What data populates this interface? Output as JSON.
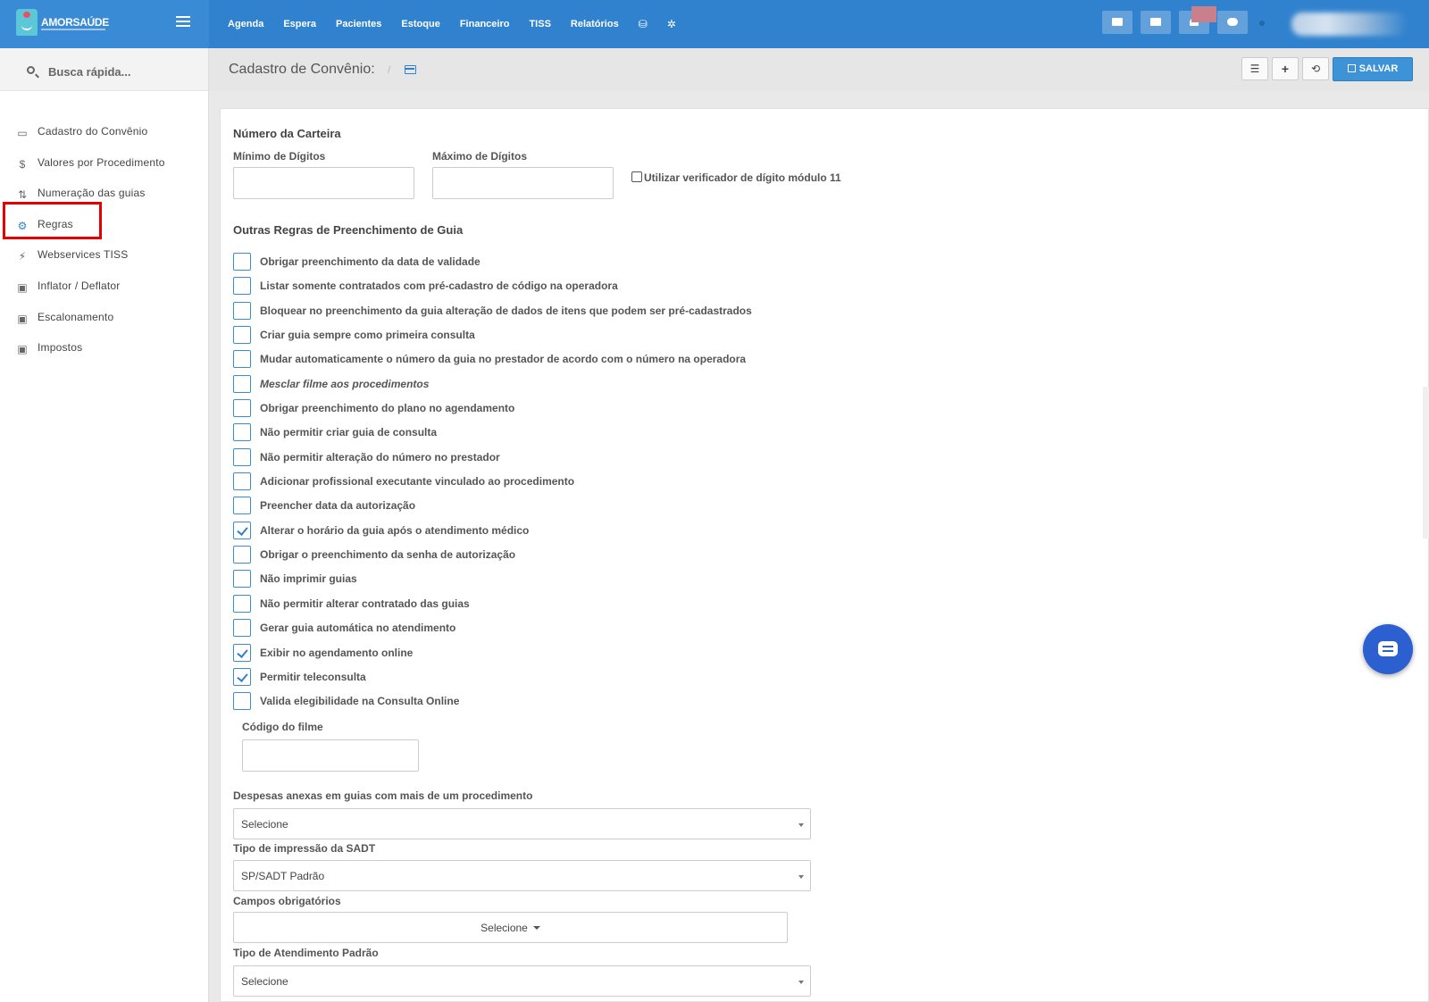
{
  "app": {
    "logo_text": "AMORSAÚDE"
  },
  "topnav": {
    "items": [
      "Agenda",
      "Espera",
      "Pacientes",
      "Estoque",
      "Financeiro",
      "TISS",
      "Relatórios"
    ]
  },
  "sidebar": {
    "search_label": "Busca rápida...",
    "items": [
      {
        "label": "Cadastro do Convênio",
        "icon": "credit-card-icon"
      },
      {
        "label": "Valores por Procedimento",
        "icon": "dollar-icon"
      },
      {
        "label": "Numeração das guias",
        "icon": "sort-numeric-icon"
      },
      {
        "label": "Regras",
        "icon": "cogs-icon"
      },
      {
        "label": "Webservices TISS",
        "icon": "plug-icon"
      },
      {
        "label": "Inflator / Deflator",
        "icon": "money-icon"
      },
      {
        "label": "Escalonamento",
        "icon": "money-icon"
      },
      {
        "label": "Impostos",
        "icon": "money-icon"
      }
    ]
  },
  "header": {
    "title": "Cadastro de Convênio:",
    "separator": "/",
    "save_label": "SALVAR",
    "add_symbol": "+",
    "list_symbol": "☰",
    "history_symbol": "⟲"
  },
  "carteira": {
    "section_title": "Número da Carteira",
    "min_label": "Mínimo de Dígitos",
    "max_label": "Máximo de Dígitos",
    "min_value": "",
    "max_value": "",
    "mod11_label": "Utilizar verificador de dígito módulo 11",
    "mod11_checked": false
  },
  "rules": {
    "section_title": "Outras Regras de Preenchimento de Guia",
    "items": [
      {
        "label": "Obrigar preenchimento da data de validade",
        "checked": false
      },
      {
        "label": "Listar somente contratados com pré-cadastro de código na operadora",
        "checked": false
      },
      {
        "label": "Bloquear no preenchimento da guia alteração de dados de itens que podem ser pré-cadastrados",
        "checked": false
      },
      {
        "label": "Criar guia sempre como primeira consulta",
        "checked": false
      },
      {
        "label": "Mudar automaticamente o número da guia no prestador de acordo com o número na operadora",
        "checked": false
      },
      {
        "label": "Mesclar filme aos procedimentos",
        "checked": false,
        "italic": true
      },
      {
        "label": "Obrigar preenchimento do plano no agendamento",
        "checked": false
      },
      {
        "label": "Não permitir criar guia de consulta",
        "checked": false
      },
      {
        "label": "Não permitir alteração do número no prestador",
        "checked": false
      },
      {
        "label": "Adicionar profissional executante vinculado ao procedimento",
        "checked": false
      },
      {
        "label": "Preencher data da autorização",
        "checked": false
      },
      {
        "label": "Alterar o horário da guia após o atendimento médico",
        "checked": true
      },
      {
        "label": "Obrigar o preenchimento da senha de autorização",
        "checked": false
      },
      {
        "label": "Não imprimir guias",
        "checked": false
      },
      {
        "label": "Não permitir alterar contratado das guias",
        "checked": false
      },
      {
        "label": "Gerar guia automática no atendimento",
        "checked": false
      },
      {
        "label": "Exibir no agendamento online",
        "checked": true
      },
      {
        "label": "Permitir teleconsulta",
        "checked": true
      },
      {
        "label": "Valida elegibilidade na Consulta Online",
        "checked": false
      }
    ]
  },
  "filme": {
    "label": "Código do filme",
    "value": ""
  },
  "despesas": {
    "label": "Despesas anexas em guias com mais de um procedimento",
    "value": "Selecione"
  },
  "sadt": {
    "label": "Tipo de impressão da SADT",
    "value": "SP/SADT Padrão"
  },
  "campos": {
    "label": "Campos obrigatórios",
    "value": "Selecione"
  },
  "atendimento": {
    "label": "Tipo de Atendimento Padrão",
    "value": "Selecione"
  },
  "colors": {
    "topbar": "#3182ce",
    "save_button": "#3d93d6",
    "checkbox_border": "#3d8bd1",
    "highlight": "#e60000"
  }
}
